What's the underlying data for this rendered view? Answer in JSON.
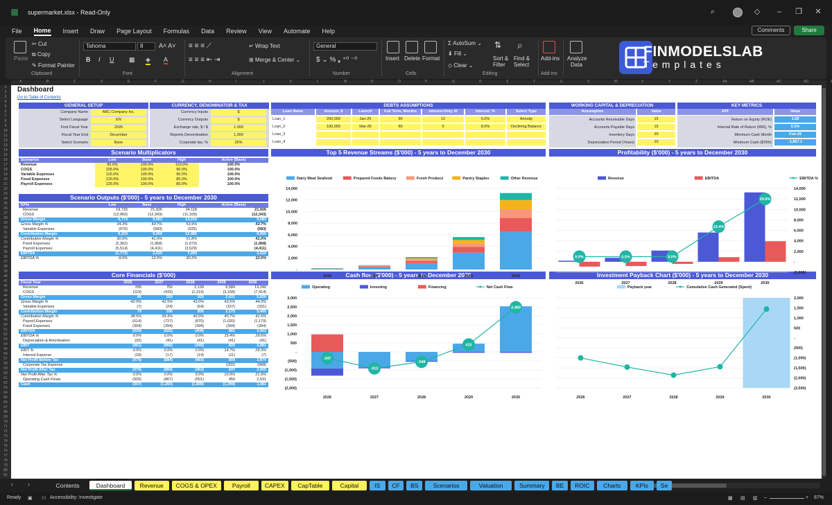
{
  "window": {
    "title": "supermarket.xlsx  -  Read-Only"
  },
  "menu": [
    "File",
    "Home",
    "Insert",
    "Draw",
    "Page Layout",
    "Formulas",
    "Data",
    "Review",
    "View",
    "Automate",
    "Help"
  ],
  "menu_active": "Home",
  "top_buttons": {
    "comments": "Comments",
    "share": "Share"
  },
  "ribbon": {
    "paste": "Paste",
    "cut": "Cut",
    "copy": "Copy",
    "format_painter": "Format Painter",
    "clipboard": "Clipboard",
    "font_name": "Tahoma",
    "font_size": "8",
    "font_group": "Font",
    "wrap_text": "Wrap Text",
    "merge_center": "Merge & Center",
    "alignment": "Alignment",
    "number_format": "General",
    "number": "Number",
    "insert": "Insert",
    "delete": "Delete",
    "format": "Format",
    "cells": "Cells",
    "autosum": "AutoSum",
    "fill": "Fill",
    "clear": "Clear",
    "sort_filter": "Sort &",
    "sort_filter2": "Filter",
    "find_select": "Find &",
    "find_select2": "Select",
    "editing": "Editing",
    "addins": "Add-ins",
    "addins_group": "Add-ins",
    "analyze": "Analyze",
    "analyze2": "Data",
    "brand1": "FINMODELSLAB",
    "brand2": "Templates"
  },
  "col_letters": [
    "A",
    "B",
    "C",
    "D",
    "E",
    "F",
    "G",
    "H",
    "I",
    "J",
    "K",
    "L",
    "M",
    "N",
    "O",
    "P",
    "Q",
    "R",
    "S",
    "T",
    "U",
    "V",
    "W",
    "X",
    "Y",
    "Z",
    "AA",
    "AB",
    "AC",
    "AD",
    "AE"
  ],
  "sheet": {
    "title": "Dashboard",
    "toc": "Go to Table of Contents",
    "general": {
      "header": "GENERAL SETUP",
      "rows": [
        [
          "Company Name",
          "ABC Company Inc."
        ],
        [
          "Select Language",
          "EN"
        ],
        [
          "First Fiscal Year",
          "2026"
        ],
        [
          "Fiscal Year End",
          "December"
        ],
        [
          "Select Scenario",
          "Base"
        ]
      ]
    },
    "currency": {
      "header": "CURRENCY, DENOMINATOR & TAX",
      "rows": [
        [
          "Currency Inputs",
          "$"
        ],
        [
          "Currency Outputs",
          "$"
        ],
        [
          "Exchange rate, $ / $",
          "1.000"
        ],
        [
          "Reports Denomination",
          "1,000"
        ],
        [
          "Corporate tax, %",
          "25%"
        ]
      ]
    },
    "debts": {
      "header": "DEBTS ASSUMPTIONS",
      "cols": [
        "Loan Name",
        "Amount, $",
        "Launch",
        "Full Term, Months",
        "Interest-Only, M",
        "Interest, %",
        "Select Type"
      ],
      "rows": [
        [
          "Loan_1",
          "200,000",
          "Jan-26",
          "90",
          "12",
          "6.0%",
          "Annuity"
        ],
        [
          "Loan_2",
          "100,000",
          "Mar-26",
          "60",
          "0",
          "8.0%",
          "Declining Balance"
        ],
        [
          "Loan_3",
          "",
          "",
          "",
          "",
          "",
          ""
        ],
        [
          "Loan_4",
          "",
          "",
          "",
          "",
          "",
          ""
        ]
      ]
    },
    "working": {
      "header": "WORKING CAPITAL & DEPRECIATION",
      "cols": [
        "Assumption",
        "Value"
      ],
      "rows": [
        [
          "Accounts Receivable Days",
          "15"
        ],
        [
          "Accounts Payable Days",
          "15"
        ],
        [
          "Inventory Days",
          "20"
        ],
        [
          "Depreciation Period (Years)",
          "10"
        ]
      ]
    },
    "metrics": {
      "header": "KEY METRICS",
      "cols": [
        "KPI",
        "Value"
      ],
      "rows": [
        [
          "Return on Equity (ROE)",
          "1.69"
        ],
        [
          "Internal Rate of Return (IRR), %",
          "0.3%"
        ],
        [
          "Minimum Cash Month",
          "Feb-29"
        ],
        [
          "Minimum Cash ($'000)",
          "-1,867.1"
        ]
      ]
    },
    "multipliers": {
      "header": "Scenario Multiplicators",
      "cols": [
        "Scenarios",
        "Low",
        "Base",
        "High",
        "Active (Base)"
      ],
      "rows": [
        [
          "Revenue",
          "90.0%",
          "100.0%",
          "110.0%",
          "100.0%"
        ],
        [
          "COGS",
          "105.0%",
          "100.0%",
          "90.0%",
          "100.0%"
        ],
        [
          "Variable Expenses",
          "115.0%",
          "100.0%",
          "90.0%",
          "100.0%"
        ],
        [
          "Fixed Expenses",
          "120.0%",
          "100.0%",
          "85.0%",
          "100.0%"
        ],
        [
          "Payroll Expenses",
          "125.0%",
          "100.0%",
          "80.0%",
          "100.0%"
        ]
      ]
    },
    "outputs": {
      "header": "Scenario Outputs ($'000) - 5 years to December 2030",
      "cols": [
        "KPIs",
        "Low",
        "Base",
        "High",
        "Active (Base)"
      ],
      "rows": [
        {
          "s": "",
          "c": [
            "Revenue",
            "19,733",
            "21,926",
            "24,118",
            "21,926"
          ]
        },
        {
          "s": "",
          "c": [
            "COGS",
            "(12,960)",
            "(12,343)",
            "(11,109)",
            "(12,343)"
          ]
        },
        {
          "s": "blue",
          "c": [
            "Gross Margin",
            "6,773",
            "9,583",
            "13,010",
            "9,583"
          ]
        },
        {
          "s": "it",
          "c": [
            "Gross Margin %",
            "34.3%",
            "43.7%",
            "53.9%",
            "43.7%"
          ]
        },
        {
          "s": "",
          "c": [
            "Variable Expenses",
            "(670)",
            "(583)",
            "(525)",
            "(583)"
          ]
        },
        {
          "s": "blue",
          "c": [
            "Contribution Margin",
            "6,103",
            "9,000",
            "12,485",
            "9,000"
          ]
        },
        {
          "s": "it",
          "c": [
            "Contribution Margin %",
            "30.9%",
            "41.0%",
            "51.8%",
            "41.0%"
          ]
        },
        {
          "s": "",
          "c": [
            "Fixed Expenses",
            "(2,362)",
            "(1,968)",
            "(1,673)",
            "(1,968)"
          ]
        },
        {
          "s": "",
          "c": [
            "Payroll Expenses",
            "(5,514)",
            "(4,411)",
            "(3,529)",
            "(4,411)"
          ]
        },
        {
          "s": "blue",
          "c": [
            "EBITDA",
            "(1,773)",
            "2,620",
            "7,283",
            "2,620"
          ]
        },
        {
          "s": "it",
          "c": [
            "EBITDA %",
            "-9.0%",
            "12.0%",
            "30.2%",
            "12.0%"
          ]
        }
      ]
    },
    "core": {
      "header": "Core Financials ($'000)",
      "cols": [
        "Fiscal Year",
        "2026",
        "2027",
        "2028",
        "2029",
        "2030"
      ],
      "rows": [
        {
          "s": "",
          "c": [
            "Revenue",
            "205",
            "752",
            "2,139",
            "5,589",
            "13,240"
          ]
        },
        {
          "s": "",
          "c": [
            "COGS",
            "(119)",
            "(433)",
            "(1,219)",
            "(3,158)",
            "(7,414)"
          ]
        },
        {
          "s": "blue",
          "c": [
            "Gross Margin",
            "86",
            "320",
            "920",
            "2,431",
            "5,826"
          ]
        },
        {
          "s": "it",
          "c": [
            "Gross Margin %",
            "42.0%",
            "42.5%",
            "43.0%",
            "43.5%",
            "44.0%"
          ]
        },
        {
          "s": "",
          "c": [
            "Variable Expenses",
            "(7)",
            "(24)",
            "(64)",
            "(157)",
            "(331)"
          ]
        },
        {
          "s": "blue",
          "c": [
            "Contribution Margin",
            "79",
            "296",
            "856",
            "2,275",
            "5,495"
          ]
        },
        {
          "s": "it",
          "c": [
            "Contribution Margin %",
            "38.5%",
            "39.3%",
            "40.0%",
            "40.7%",
            "41.5%"
          ]
        },
        {
          "s": "",
          "c": [
            "Payroll Expenses",
            "(614)",
            "(727)",
            "(870)",
            "(1,020)",
            "(1,179)"
          ]
        },
        {
          "s": "",
          "c": [
            "Fixed Expenses",
            "(394)",
            "(394)",
            "(394)",
            "(394)",
            "(394)"
          ]
        },
        {
          "s": "blue",
          "c": [
            "EBITDA",
            "(929)",
            "(825)",
            "(408)",
            "881",
            "3,922"
          ]
        },
        {
          "s": "it",
          "c": [
            "EBITDA %",
            "0.0%",
            "0.0%",
            "0.0%",
            "15.4%",
            "29.6%"
          ]
        },
        {
          "s": "",
          "c": [
            "Depreciation & Amortization",
            "(32)",
            "(41)",
            "(41)",
            "(41)",
            "(41)"
          ]
        },
        {
          "s": "blue",
          "c": [
            "EBIT",
            "(961)",
            "(866)",
            "(449)",
            "820",
            "3,881"
          ]
        },
        {
          "s": "it",
          "c": [
            "EBIT %",
            "0.0%",
            "0.0%",
            "0.0%",
            "14.7%",
            "29.3%"
          ]
        },
        {
          "s": "",
          "c": [
            "Interest Expense",
            "(18)",
            "(17)",
            "(14)",
            "(11)",
            "(7)"
          ]
        },
        {
          "s": "blue",
          "c": [
            "Net Profit Before Tax",
            "(979)",
            "(884)",
            "(463)",
            "809",
            "3,874"
          ]
        },
        {
          "s": "",
          "c": [
            "Corporate Tax Expense",
            "-",
            "-",
            "-",
            "(202)",
            "(968)"
          ]
        },
        {
          "s": "blue",
          "c": [
            "Net Profit After Tax",
            "(979)",
            "(884)",
            "(463)",
            "607",
            "2,905"
          ]
        },
        {
          "s": "it",
          "c": [
            "Net Profit After Tax %",
            "0.0%",
            "0.0%",
            "0.0%",
            "10.9%",
            "21.9%"
          ]
        },
        {
          "s": "",
          "c": [
            "Operating Cash Flows",
            "(920)",
            "(867)",
            "(501)",
            "459",
            "2,531"
          ]
        },
        {
          "s": "blue",
          "c": [
            "Cash",
            "(347)",
            "(1,260)",
            "(1,808)",
            "(1,399)",
            "1,081"
          ]
        }
      ]
    }
  },
  "chart_data": [
    {
      "type": "bar",
      "stacked": true,
      "title": "Top 5 Revenue Streams ($'000) - 5 years to December 2030",
      "categories": [
        "2026",
        "2027",
        "2028",
        "2029",
        "2030"
      ],
      "ylim": [
        0,
        14000
      ],
      "yticks": [
        "-",
        "2,000",
        "4,000",
        "6,000",
        "8,000",
        "10,000",
        "12,000",
        "14,000"
      ],
      "series": [
        {
          "name": "Dairy Meat Seafood",
          "color": "#4aa8e8",
          "values": [
            120,
            400,
            1100,
            2900,
            6500
          ]
        },
        {
          "name": "Prepared Foods Bakery",
          "color": "#e85a5a",
          "values": [
            35,
            130,
            380,
            1000,
            2400
          ]
        },
        {
          "name": "Fresh Produce",
          "color": "#f89878",
          "values": [
            20,
            80,
            220,
            600,
            1500
          ]
        },
        {
          "name": "Pantry Staples",
          "color": "#f5b21e",
          "values": [
            20,
            80,
            230,
            600,
            1600
          ]
        },
        {
          "name": "Other Revenue",
          "color": "#20b5a5",
          "values": [
            10,
            60,
            210,
            500,
            1200
          ]
        }
      ],
      "legend": "top"
    },
    {
      "type": "bar",
      "title": "Profitability ($'000) - 5 years to December 2030",
      "categories": [
        "2026",
        "2027",
        "2028",
        "2029",
        "2030"
      ],
      "ylim_left": [
        0,
        14000
      ],
      "yticks_left": [
        "14,000",
        "12,000",
        "10,000",
        "8,000",
        "6,000",
        "4,000",
        "2,000",
        "-",
        "(2,000)"
      ],
      "series": [
        {
          "name": "Revenue",
          "color": "#4b59d6",
          "values": [
            205,
            752,
            2139,
            5589,
            13240
          ]
        },
        {
          "name": "EBITDA",
          "color": "#e85a5a",
          "values": [
            -929,
            -825,
            -408,
            881,
            3922
          ]
        },
        {
          "name": "EBITDA %",
          "color": "#20b5a5",
          "type": "line",
          "values": [
            0.0,
            0.0,
            0.0,
            15.4,
            29.6
          ],
          "labels": [
            "0.0%",
            "0.0%",
            "0.0%",
            "15.4%",
            "29.6%"
          ]
        }
      ],
      "legend": "top"
    },
    {
      "type": "bar",
      "title": "Cash flow ($'000) - 5 years to December 2030",
      "categories": [
        "2026",
        "2027",
        "2028",
        "2029",
        "2030"
      ],
      "ylim": [
        -2000,
        3000
      ],
      "yticks": [
        "3,000",
        "2,500",
        "2,000",
        "1,500",
        "1,000",
        "500",
        "-",
        "(500)",
        "(1,000)",
        "(1,500)",
        "(2,000)"
      ],
      "series": [
        {
          "name": "Operating",
          "color": "#4aa8e8",
          "values": [
            -920,
            -867,
            -501,
            459,
            2531
          ]
        },
        {
          "name": "Investing",
          "color": "#4b59d6",
          "values": [
            -400,
            -46,
            -47,
            -49,
            -51
          ]
        },
        {
          "name": "Financing",
          "color": "#e85a5a",
          "values": [
            973,
            0,
            0,
            0,
            0
          ]
        },
        {
          "name": "Net Cash Flow",
          "color": "#20b5a5",
          "type": "line",
          "values": [
            -347,
            -913,
            -548,
            410,
            2480
          ],
          "labels": [
            "-347",
            "-913",
            "-548",
            "410",
            "2,480"
          ]
        }
      ],
      "legend": "top"
    },
    {
      "type": "bar",
      "title": "Investment Payback Chart ($'000) - 5 years to December 2030",
      "categories": [
        "2026",
        "2027",
        "2028",
        "2029",
        "2030"
      ],
      "yticks_right": [
        "2,000",
        "1,500",
        "1,000",
        "500",
        "-",
        "(500)",
        "(1,000)",
        "(1,500)",
        "(2,000)",
        "(2,500)"
      ],
      "series": [
        {
          "name": "Payback year",
          "color": "#a8d8f5",
          "values": [
            0,
            0,
            0,
            0,
            1
          ]
        },
        {
          "name": "Cumulative Cash Generated (Spent)",
          "color": "#20b5a5",
          "type": "line",
          "values": [
            -1000,
            -1460,
            -1860,
            -1440,
            1440
          ]
        }
      ],
      "legend": "top"
    }
  ],
  "tabs": [
    {
      "label": "Contents",
      "style": "plain"
    },
    {
      "label": "Dashboard",
      "style": "active"
    },
    {
      "label": "Revenue",
      "style": "yellow"
    },
    {
      "label": "COGS & OPEX",
      "style": "yellow"
    },
    {
      "label": "Payroll",
      "style": "yellow"
    },
    {
      "label": "CAPEX",
      "style": "yellow"
    },
    {
      "label": "CapTable",
      "style": "yellow"
    },
    {
      "label": "Capital",
      "style": "yellow"
    },
    {
      "label": "IS",
      "style": "blue"
    },
    {
      "label": "CF",
      "style": "blue"
    },
    {
      "label": "BS",
      "style": "blue"
    },
    {
      "label": "Scenarios",
      "style": "blue"
    },
    {
      "label": "Valuation",
      "style": "blue"
    },
    {
      "label": "Summary",
      "style": "blue"
    },
    {
      "label": "BE",
      "style": "blue"
    },
    {
      "label": "ROIC",
      "style": "blue"
    },
    {
      "label": "Charts",
      "style": "blue"
    },
    {
      "label": "KPIs",
      "style": "blue"
    },
    {
      "label": "Se",
      "style": "blue"
    }
  ],
  "status": {
    "ready": "Ready",
    "accessibility": "Accessibility: Investigate",
    "zoom": "87%"
  }
}
